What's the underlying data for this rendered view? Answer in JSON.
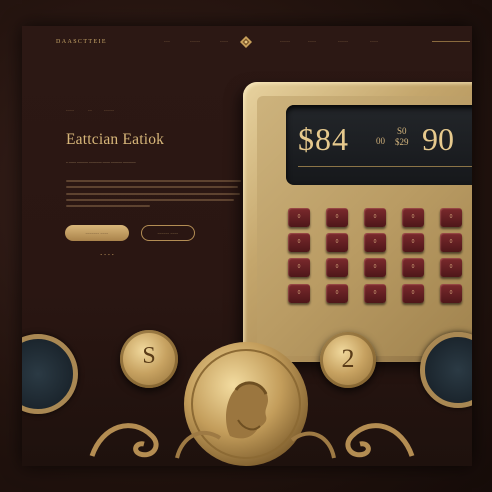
{
  "header": {
    "brand": "DAASCTTEIE",
    "nav": [
      "–––",
      "–––––",
      "––––",
      "–––––",
      "––––",
      "–––––",
      "––––"
    ]
  },
  "hero": {
    "kicker_1": "––––",
    "kicker_2": "––",
    "kicker_3": "–––––",
    "title": "Eattcian Eatiok",
    "subtitle": "– –––– –––––– ––––––– –––– –––––– –––––––",
    "primary_button": "––––––– ––––",
    "secondary_button": "–––––– ––––",
    "dots": "••••"
  },
  "calculator": {
    "display_main": "$84",
    "display_small": "00",
    "display_stack_top": "S0",
    "display_stack_bottom": "$29",
    "display_right": "90",
    "keys": [
      "0",
      "0",
      "0",
      "0",
      "0",
      "0",
      "0",
      "0",
      "0",
      "0",
      "0",
      "0",
      "0",
      "0",
      "0",
      "0",
      "0",
      "0",
      "0",
      "0",
      "0",
      "0",
      "0",
      "0",
      "0"
    ]
  },
  "coins": {
    "left_coin": "S",
    "right_coin": "2"
  },
  "colors": {
    "gold": "#d8b77a",
    "key_red": "#6b2326",
    "background": "#2a1612"
  }
}
